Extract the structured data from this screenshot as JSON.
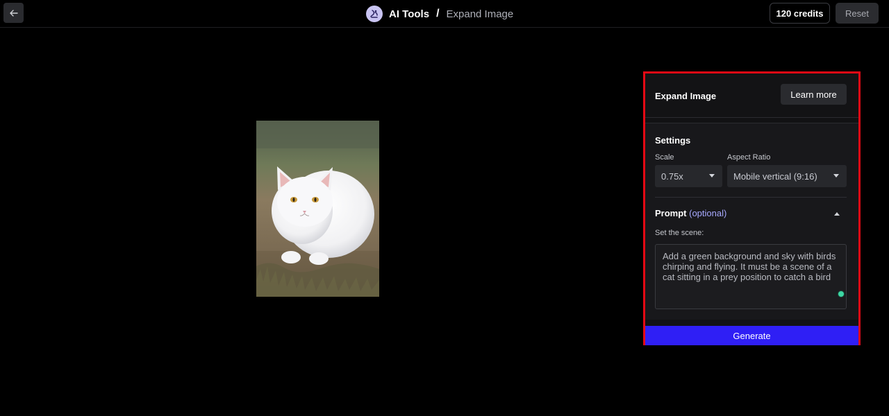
{
  "header": {
    "back_icon": "arrow-left-icon",
    "brand_icon": "ai-tools-logo-icon",
    "title": "AI Tools",
    "separator": "/",
    "subtitle": "Expand Image",
    "credits": "120 credits",
    "reset_label": "Reset"
  },
  "canvas": {
    "image_subject": "white-cat-photo"
  },
  "panel": {
    "title": "Expand Image",
    "learn_more_label": "Learn more",
    "settings_title": "Settings",
    "scale": {
      "label": "Scale",
      "value": "0.75x"
    },
    "aspect_ratio": {
      "label": "Aspect Ratio",
      "value": "Mobile vertical (9:16)"
    },
    "prompt": {
      "title": "Prompt",
      "optional": "(optional)",
      "scene_label": "Set the scene:",
      "text": "Add a green background and sky with birds chirping and flying. It must be a scene of a cat sitting in a prey position to catch a bird"
    },
    "generate_label": "Generate"
  },
  "colors": {
    "background": "#000000",
    "accent": "#2f1ff5",
    "highlight_border": "#e50914",
    "status_dot": "#3dd6a3"
  }
}
